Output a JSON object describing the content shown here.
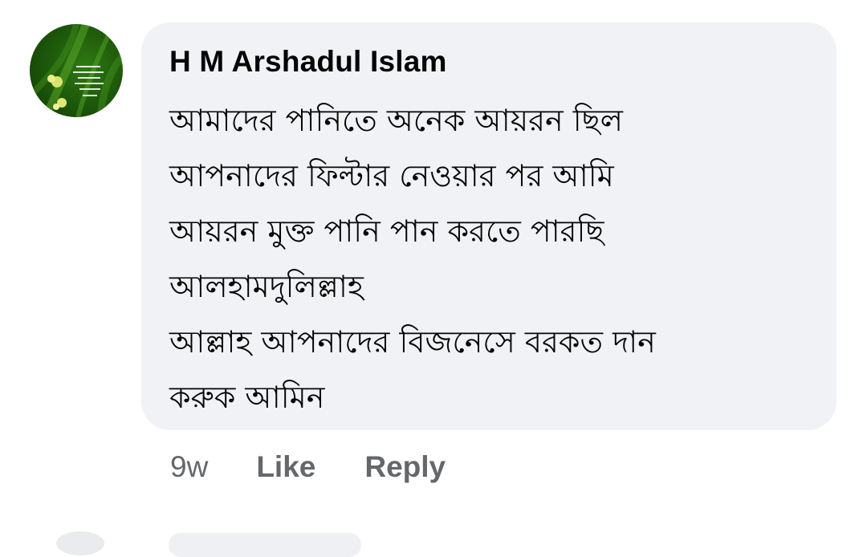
{
  "comment": {
    "author": "H M Arshadul Islam",
    "lines": [
      "আমাদের পানিতে অনেক আয়রন ছিল",
      "আপনাদের ফিল্টার নেওয়ার পর আমি",
      "আয়রন মুক্ত পানি পান করতে পারছি",
      "আলহামদুলিল্লাহ",
      "আল্লাহ আপনাদের বিজনেসে বরকত দান",
      "করুক আমিন"
    ],
    "time": "9w",
    "like_label": "Like",
    "reply_label": "Reply"
  },
  "colors": {
    "bubble": "#f0f2f5",
    "text": "#050505",
    "meta": "#65676b",
    "avatar_green": "#1f5c0b"
  },
  "icons": {
    "avatar": "profile-photo-green-leaves"
  }
}
